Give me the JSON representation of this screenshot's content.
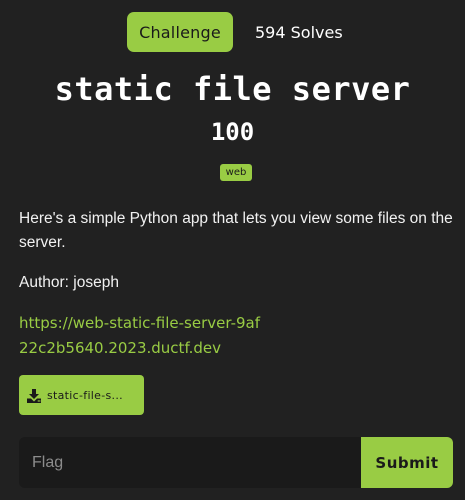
{
  "header": {
    "tab_challenge": "Challenge",
    "tab_solves": "594 Solves"
  },
  "challenge": {
    "title": "static file server",
    "points": "100",
    "category": "web",
    "description": "Here's a simple Python app that lets you view some files on the server.",
    "author": "Author: joseph",
    "link_text": "https://web-static-file-server-9af22c2b5640.2023.ductf.dev",
    "file_name": "static-file-s..."
  },
  "form": {
    "flag_placeholder": "Flag",
    "submit_label": "Submit"
  },
  "colors": {
    "background": "#212121",
    "accent": "#99cc44",
    "input_background": "#1a1a1a"
  },
  "icons": {
    "file_button": "download-icon"
  }
}
